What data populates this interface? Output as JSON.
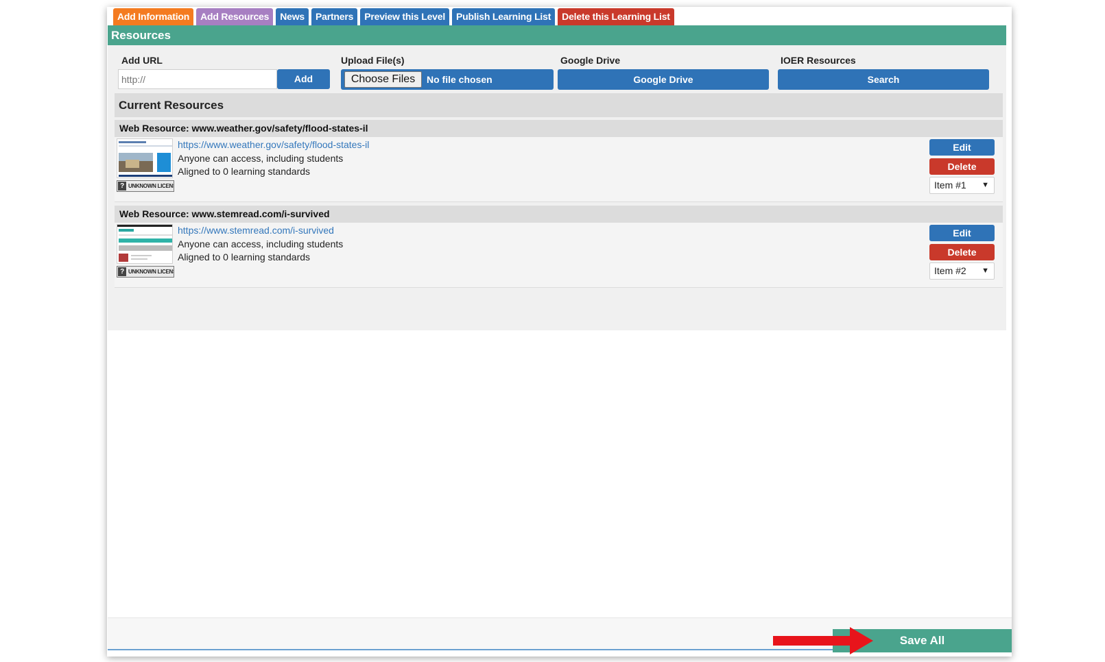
{
  "tabs": [
    {
      "label": "Add Information",
      "color": "#f47b20"
    },
    {
      "label": "Add Resources",
      "color": "#a77fc2"
    },
    {
      "label": "News",
      "color": "#2f73b7"
    },
    {
      "label": "Partners",
      "color": "#2f73b7"
    },
    {
      "label": "Preview this Level",
      "color": "#2f73b7"
    },
    {
      "label": "Publish Learning List",
      "color": "#2f73b7"
    },
    {
      "label": "Delete this Learning List",
      "color": "#c9392b"
    }
  ],
  "section": {
    "title": "Resources",
    "color": "#4aa48d"
  },
  "add_url": {
    "label": "Add URL",
    "placeholder": "http://",
    "button": "Add"
  },
  "upload": {
    "label": "Upload File(s)",
    "choose_button": "Choose Files",
    "status": "No file chosen"
  },
  "google_drive": {
    "label": "Google Drive",
    "button": "Google Drive"
  },
  "ioer": {
    "label": "IOER Resources",
    "button": "Search"
  },
  "current": {
    "title": "Current Resources"
  },
  "resources": [
    {
      "header": "Web Resource: www.weather.gov/safety/flood-states-il",
      "link": "https://www.weather.gov/safety/flood-states-il",
      "access": "Anyone can access, including students",
      "standards": "Aligned to 0 learning standards",
      "license": "UNKNOWN LICENSE",
      "edit": "Edit",
      "delete": "Delete",
      "order": "Item #1"
    },
    {
      "header": "Web Resource: www.stemread.com/i-survived",
      "link": "https://www.stemread.com/i-survived",
      "access": "Anyone can access, including students",
      "standards": "Aligned to 0 learning standards",
      "license": "UNKNOWN LICENSE",
      "edit": "Edit",
      "delete": "Delete",
      "order": "Item #2"
    }
  ],
  "footer": {
    "save_label": "Save All"
  },
  "colors": {
    "primary_blue": "#2f73b7",
    "danger_red": "#c9392b",
    "teal": "#4aa48d",
    "annotation_arrow": "#e8141b"
  }
}
